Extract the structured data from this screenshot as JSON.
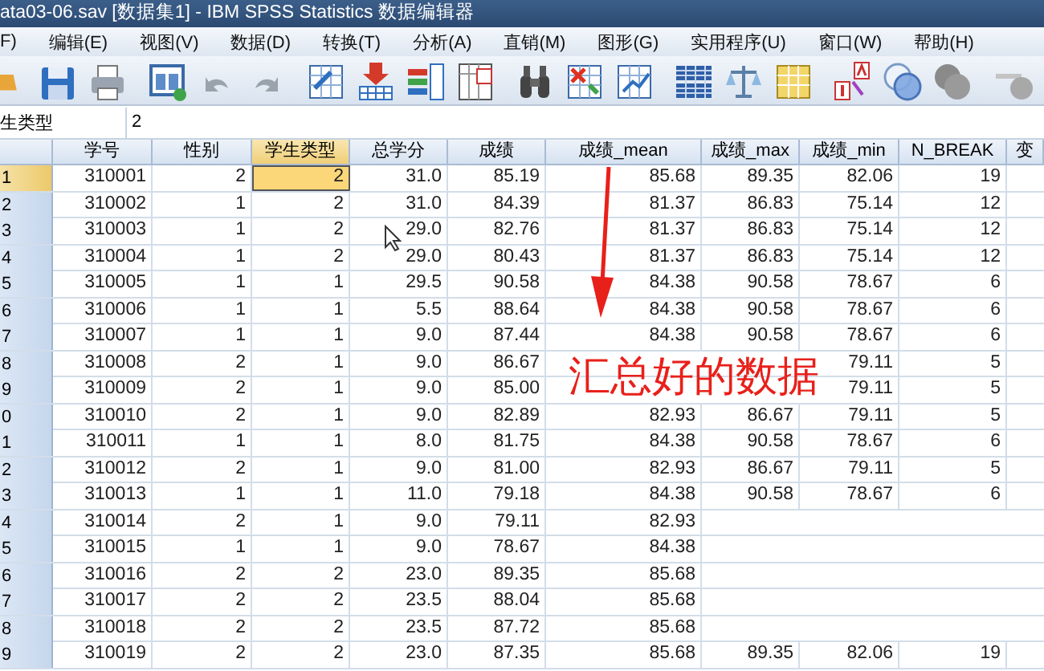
{
  "window": {
    "title": "ata03-06.sav [数据集1] - IBM SPSS Statistics 数据编辑器"
  },
  "menu": [
    "F)",
    "编辑(E)",
    "视图(V)",
    "数据(D)",
    "转换(T)",
    "分析(A)",
    "直销(M)",
    "图形(G)",
    "实用程序(U)",
    "窗口(W)",
    "帮助(H)"
  ],
  "cell_reference": {
    "variable": "生类型",
    "value": "2"
  },
  "table": {
    "columns": [
      {
        "label": "学号",
        "selected": false
      },
      {
        "label": "性别",
        "selected": false
      },
      {
        "label": "学生类型",
        "selected": true
      },
      {
        "label": "总学分",
        "selected": false
      },
      {
        "label": "成绩",
        "selected": false
      },
      {
        "label": "成绩_mean",
        "selected": false
      },
      {
        "label": "成绩_max",
        "selected": false
      },
      {
        "label": "成绩_min",
        "selected": false
      },
      {
        "label": "N_BREAK",
        "selected": false
      },
      {
        "label": "变",
        "selected": false
      }
    ],
    "rows": [
      {
        "label": "1",
        "selected": true,
        "cells": [
          "310001",
          "2",
          "2",
          "31.0",
          "85.19",
          "85.68",
          "89.35",
          "82.06",
          "19"
        ]
      },
      {
        "label": "2",
        "selected": false,
        "cells": [
          "310002",
          "1",
          "2",
          "31.0",
          "84.39",
          "81.37",
          "86.83",
          "75.14",
          "12"
        ]
      },
      {
        "label": "3",
        "selected": false,
        "cells": [
          "310003",
          "1",
          "2",
          "29.0",
          "82.76",
          "81.37",
          "86.83",
          "75.14",
          "12"
        ]
      },
      {
        "label": "4",
        "selected": false,
        "cells": [
          "310004",
          "1",
          "2",
          "29.0",
          "80.43",
          "81.37",
          "86.83",
          "75.14",
          "12"
        ]
      },
      {
        "label": "5",
        "selected": false,
        "cells": [
          "310005",
          "1",
          "1",
          "29.5",
          "90.58",
          "84.38",
          "90.58",
          "78.67",
          "6"
        ]
      },
      {
        "label": "6",
        "selected": false,
        "cells": [
          "310006",
          "1",
          "1",
          "5.5",
          "88.64",
          "84.38",
          "90.58",
          "78.67",
          "6"
        ]
      },
      {
        "label": "7",
        "selected": false,
        "cells": [
          "310007",
          "1",
          "1",
          "9.0",
          "87.44",
          "84.38",
          "90.58",
          "78.67",
          "6"
        ]
      },
      {
        "label": "8",
        "selected": false,
        "cells": [
          "310008",
          "2",
          "1",
          "9.0",
          "86.67",
          null,
          null,
          "79.11",
          "5"
        ]
      },
      {
        "label": "9",
        "selected": false,
        "cells": [
          "310009",
          "2",
          "1",
          "9.0",
          "85.00",
          null,
          null,
          "79.11",
          "5"
        ]
      },
      {
        "label": "0",
        "selected": false,
        "cells": [
          "310010",
          "2",
          "1",
          "9.0",
          "82.89",
          "82.93",
          "86.67",
          "79.11",
          "5"
        ]
      },
      {
        "label": "1",
        "selected": false,
        "cells": [
          "310011",
          "1",
          "1",
          "8.0",
          "81.75",
          "84.38",
          "90.58",
          "78.67",
          "6"
        ]
      },
      {
        "label": "2",
        "selected": false,
        "cells": [
          "310012",
          "2",
          "1",
          "9.0",
          "81.00",
          "82.93",
          "86.67",
          "79.11",
          "5"
        ]
      },
      {
        "label": "3",
        "selected": false,
        "cells": [
          "310013",
          "1",
          "1",
          "11.0",
          "79.18",
          "84.38",
          "90.58",
          "78.67",
          "6"
        ]
      },
      {
        "label": "4",
        "selected": false,
        "cells": [
          "310014",
          "2",
          "1",
          "9.0",
          "79.11",
          "82.93"
        ]
      },
      {
        "label": "5",
        "selected": false,
        "cells": [
          "310015",
          "1",
          "1",
          "9.0",
          "78.67",
          "84.38"
        ]
      },
      {
        "label": "6",
        "selected": false,
        "cells": [
          "310016",
          "2",
          "2",
          "23.0",
          "89.35",
          "85.68"
        ]
      },
      {
        "label": "7",
        "selected": false,
        "cells": [
          "310017",
          "2",
          "2",
          "23.5",
          "88.04",
          "85.68"
        ]
      },
      {
        "label": "8",
        "selected": false,
        "cells": [
          "310018",
          "2",
          "2",
          "23.5",
          "87.72",
          "85.68"
        ]
      },
      {
        "label": "9",
        "selected": false,
        "cells": [
          "310019",
          "2",
          "2",
          "23.0",
          "87.35",
          "85.68",
          "89.35",
          "82.06",
          "19"
        ]
      }
    ]
  },
  "annotation": {
    "text": "汇总好的数据"
  }
}
